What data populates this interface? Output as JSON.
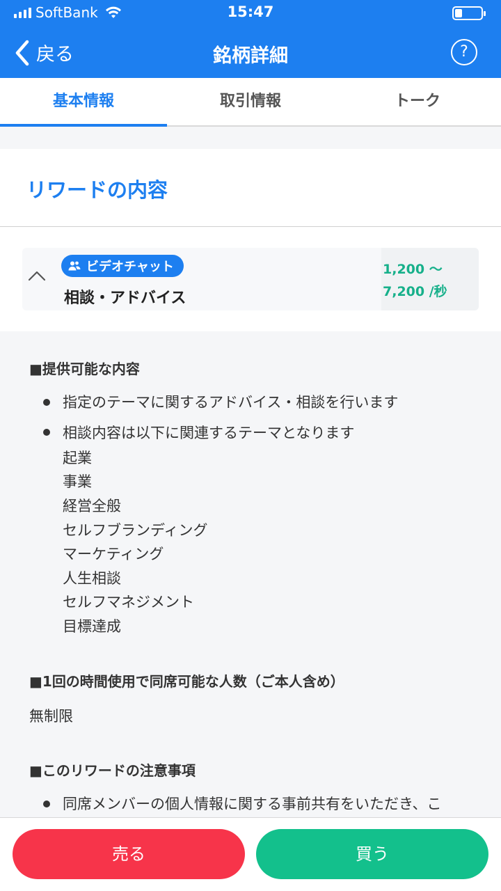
{
  "status": {
    "carrier": "SoftBank",
    "time": "15:47"
  },
  "nav": {
    "back_label": "戻る",
    "title": "銘柄詳細",
    "help_label": "?"
  },
  "tabs": [
    {
      "label": "基本情報",
      "active": true
    },
    {
      "label": "取引情報",
      "active": false
    },
    {
      "label": "トーク",
      "active": false
    }
  ],
  "section": {
    "title": "リワードの内容"
  },
  "reward": {
    "badge": "ビデオチャット",
    "name": "相談・アドバイス",
    "price_line1": "1,200 〜",
    "price_line2": "7,200 /秒"
  },
  "detail": {
    "section1_heading": "■提供可能な内容",
    "items": [
      "指定のテーマに関するアドバイス・相談を行います",
      "相談内容は以下に関連するテーマとなります"
    ],
    "topics": [
      "起業",
      "事業",
      "経営全般",
      "セルフブランディング",
      "マーケティング",
      "人生相談",
      "セルフマネジメント",
      "目標達成"
    ],
    "section2_heading": "■1回の時間使用で同席可能な人数（ご本人含め）",
    "section2_value": "無制限",
    "section3_heading": "■このリワードの注意事項",
    "section3_item": "同席メンバーの個人情報に関する事前共有をいただき、こ"
  },
  "actions": {
    "sell_label": "売る",
    "buy_label": "買う"
  },
  "colors": {
    "primary": "#1d7ff0",
    "sell": "#f7344a",
    "buy": "#13c08c",
    "price": "#16b08a"
  }
}
